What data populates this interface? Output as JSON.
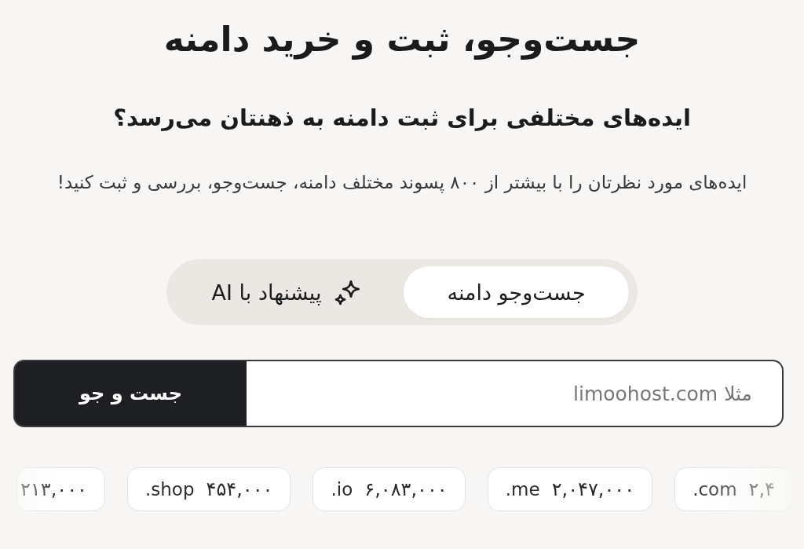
{
  "header": {
    "title": "جست‌وجو، ثبت و خرید دامنه",
    "subtitle": "ایده‌های مختلفی برای ثبت دامنه به ذهنتان می‌رسد؟",
    "description": "ایده‌های مورد نظرتان را با بیشتر از ۸۰۰ پسوند مختلف دامنه، جست‌وجو، بررسی و ثبت کنید!"
  },
  "mode_tabs": [
    {
      "label": "جست‌وجو دامنه",
      "selected": true,
      "kind": "plain"
    },
    {
      "label": "پیشنهاد با AI",
      "selected": false,
      "kind": "ai"
    }
  ],
  "search": {
    "placeholder": "مثلا limoohost.com",
    "button": "جست و جو"
  },
  "domain_prices": [
    {
      "extension": ".com",
      "price": "۲,۴"
    },
    {
      "extension": ".me",
      "price": "۲,۰۴۷,۰۰۰"
    },
    {
      "extension": ".io",
      "price": "۶,۰۸۳,۰۰۰"
    },
    {
      "extension": ".shop",
      "price": "۴۵۴,۰۰۰"
    },
    {
      "price": "۲۱۳,۰۰۰"
    }
  ]
}
